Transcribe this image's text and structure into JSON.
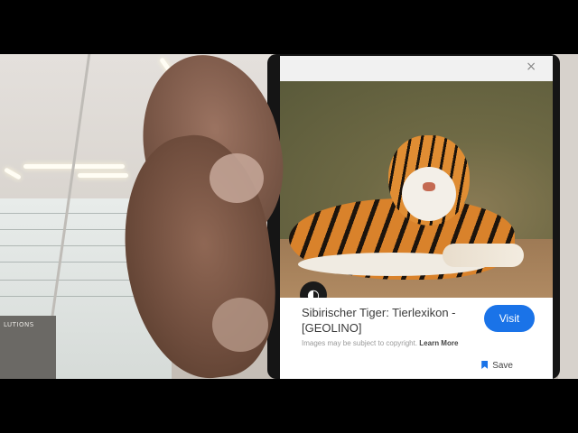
{
  "screen": {
    "result": {
      "title": "Sibirischer Tiger: Tierlexikon - [GEOLINO]",
      "disclaimer": "Images may be subject to copyright.",
      "learn_more": "Learn More",
      "visit_label": "Visit",
      "save_label": "Save"
    },
    "close_glyph": "×"
  },
  "background": {
    "sign_text": "LUTIONS"
  },
  "colors": {
    "accent": "#1a73e8"
  }
}
